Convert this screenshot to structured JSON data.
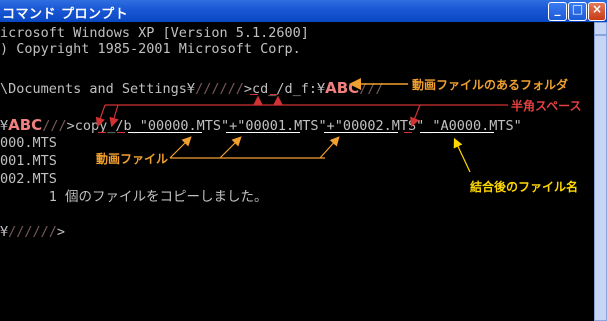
{
  "window": {
    "title": "コマンド プロンプト",
    "min_glyph": "_",
    "max_glyph": "□",
    "close_glyph": "×"
  },
  "console": {
    "lines": [
      "icrosoft Windows XP [Version 5.1.2600]",
      ") Copyright 1985-2001 Microsoft Corp."
    ],
    "cmd1": {
      "prefix": "\\Documents and Settings¥",
      "redact": "//////",
      "prompt": ">cd_/d_f:¥",
      "folder": "ABC",
      "tail": "///"
    },
    "cmd2": {
      "prefix": "¥",
      "folder": "ABC",
      "redact": "///",
      "prompt": ">copy_/b_\"00000.MTS\"+\"00001.MTS\"+\"00002.MTS\"_\"A0000.MTS\""
    },
    "outputs": [
      "000.MTS",
      "001.MTS",
      "002.MTS"
    ],
    "result": "      1 個のファイルをコピーしました。",
    "final_prompt_prefix": "¥",
    "final_redact": "//////",
    "final_prompt_suffix": ">"
  },
  "annotations": {
    "folder_label": "動画ファイルのあるフォルダ",
    "space_label": "半角スペース",
    "video_files_label": "動画ファイル",
    "merged_file_label": "結合後のファイル名"
  },
  "colors": {
    "title_bar": "#0a47c2",
    "console_bg": "#000000",
    "console_text": "#c0c0c0",
    "folder_annotation": "#f0a030",
    "space_annotation": "#d23232",
    "video_annotation": "#f0a030",
    "merged_annotation": "#ffd700"
  }
}
